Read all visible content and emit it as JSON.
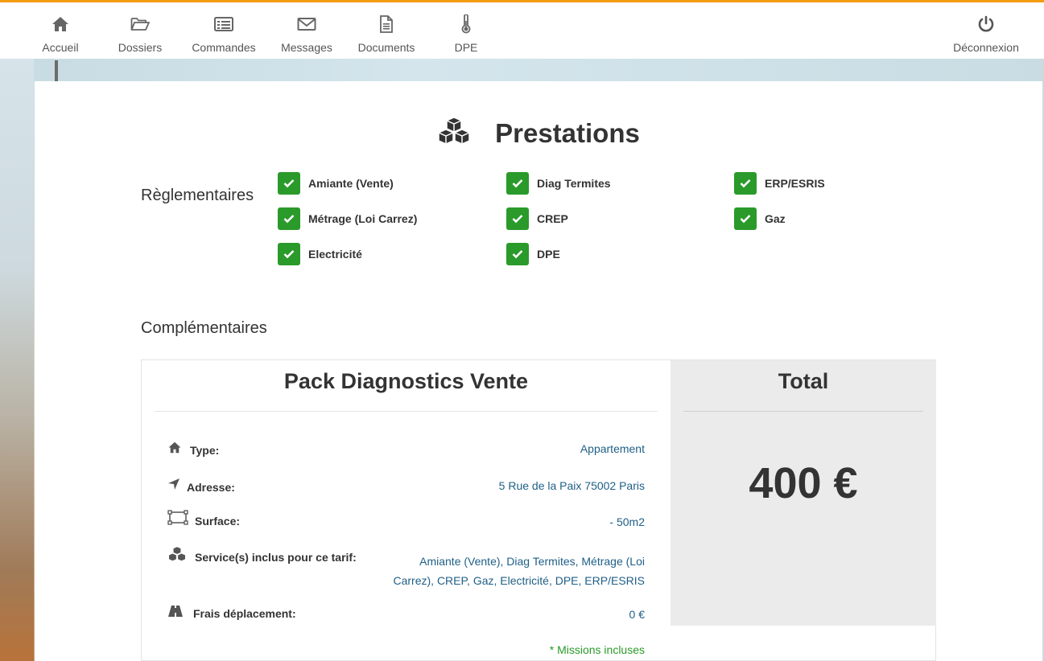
{
  "nav": {
    "items": [
      {
        "label": "Accueil",
        "icon": "home-icon"
      },
      {
        "label": "Dossiers",
        "icon": "folder-icon"
      },
      {
        "label": "Commandes",
        "icon": "list-icon"
      },
      {
        "label": "Messages",
        "icon": "envelope-icon"
      },
      {
        "label": "Documents",
        "icon": "document-icon"
      },
      {
        "label": "DPE",
        "icon": "thermometer-icon"
      }
    ],
    "logout": {
      "label": "Déconnexion",
      "icon": "power-icon"
    }
  },
  "colors": {
    "accent": "#f39c12",
    "check": "#2a9a2a",
    "value_text": "#1f5f86",
    "total_bg": "#ebebeb"
  },
  "prestations": {
    "title": "Prestations",
    "title_icon": "cubes-icon",
    "reglementaires_label": "Règlementaires",
    "items": [
      "Amiante (Vente)",
      "Diag Termites",
      "ERP/ESRIS",
      "Métrage (Loi Carrez)",
      "CREP",
      "Gaz",
      "Electricité",
      "DPE"
    ],
    "complementaires_label": "Complémentaires"
  },
  "pack": {
    "title": "Pack Diagnostics Vente",
    "rows": [
      {
        "label": "Type:",
        "value": "Appartement",
        "icon": "home-icon"
      },
      {
        "label": "Adresse:",
        "value": "5 Rue de la Paix 75002 Paris",
        "icon": "location-arrow-icon"
      },
      {
        "label": "Surface:",
        "value": "- 50m2",
        "icon": "surface-icon"
      },
      {
        "label": "Service(s) inclus pour ce tarif:",
        "value_line1": "Amiante (Vente), Diag Termites, Métrage (Loi",
        "value_line2": "Carrez), CREP, Gaz, Electricité, DPE, ERP/ESRIS",
        "icon": "cubes-icon"
      },
      {
        "label": "Frais déplacement:",
        "value": "0 €",
        "icon": "road-icon"
      }
    ],
    "missions_note": "* Missions incluses"
  },
  "total": {
    "title": "Total",
    "amount": "400 €"
  }
}
